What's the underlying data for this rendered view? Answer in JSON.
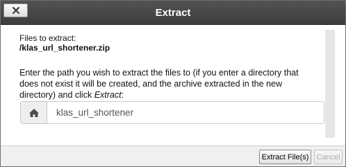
{
  "dialog": {
    "title": "Extract",
    "close_icon": "close-icon"
  },
  "content": {
    "files_label": "Files to extract:",
    "filename": "/klas_url_shortener.zip",
    "instructions_before": "Enter the path you wish to extract the files to (if you enter a directory that does not exist it will be created, and the archive extracted in the new directory) and click ",
    "instructions_emphasis": "Extract",
    "instructions_after": ":",
    "path_icon": "home-icon",
    "path_value": "klas_url_shortener"
  },
  "footer": {
    "extract_label": "Extract File(s)",
    "cancel_label": "Cancel"
  }
}
